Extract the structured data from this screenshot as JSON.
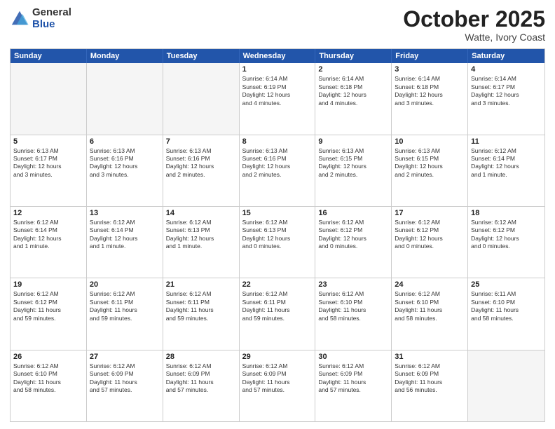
{
  "header": {
    "logo_general": "General",
    "logo_blue": "Blue",
    "month": "October 2025",
    "location": "Watte, Ivory Coast"
  },
  "days_of_week": [
    "Sunday",
    "Monday",
    "Tuesday",
    "Wednesday",
    "Thursday",
    "Friday",
    "Saturday"
  ],
  "weeks": [
    [
      {
        "day": "",
        "info": ""
      },
      {
        "day": "",
        "info": ""
      },
      {
        "day": "",
        "info": ""
      },
      {
        "day": "1",
        "info": "Sunrise: 6:14 AM\nSunset: 6:19 PM\nDaylight: 12 hours\nand 4 minutes."
      },
      {
        "day": "2",
        "info": "Sunrise: 6:14 AM\nSunset: 6:18 PM\nDaylight: 12 hours\nand 4 minutes."
      },
      {
        "day": "3",
        "info": "Sunrise: 6:14 AM\nSunset: 6:18 PM\nDaylight: 12 hours\nand 3 minutes."
      },
      {
        "day": "4",
        "info": "Sunrise: 6:14 AM\nSunset: 6:17 PM\nDaylight: 12 hours\nand 3 minutes."
      }
    ],
    [
      {
        "day": "5",
        "info": "Sunrise: 6:13 AM\nSunset: 6:17 PM\nDaylight: 12 hours\nand 3 minutes."
      },
      {
        "day": "6",
        "info": "Sunrise: 6:13 AM\nSunset: 6:16 PM\nDaylight: 12 hours\nand 3 minutes."
      },
      {
        "day": "7",
        "info": "Sunrise: 6:13 AM\nSunset: 6:16 PM\nDaylight: 12 hours\nand 2 minutes."
      },
      {
        "day": "8",
        "info": "Sunrise: 6:13 AM\nSunset: 6:16 PM\nDaylight: 12 hours\nand 2 minutes."
      },
      {
        "day": "9",
        "info": "Sunrise: 6:13 AM\nSunset: 6:15 PM\nDaylight: 12 hours\nand 2 minutes."
      },
      {
        "day": "10",
        "info": "Sunrise: 6:13 AM\nSunset: 6:15 PM\nDaylight: 12 hours\nand 2 minutes."
      },
      {
        "day": "11",
        "info": "Sunrise: 6:12 AM\nSunset: 6:14 PM\nDaylight: 12 hours\nand 1 minute."
      }
    ],
    [
      {
        "day": "12",
        "info": "Sunrise: 6:12 AM\nSunset: 6:14 PM\nDaylight: 12 hours\nand 1 minute."
      },
      {
        "day": "13",
        "info": "Sunrise: 6:12 AM\nSunset: 6:14 PM\nDaylight: 12 hours\nand 1 minute."
      },
      {
        "day": "14",
        "info": "Sunrise: 6:12 AM\nSunset: 6:13 PM\nDaylight: 12 hours\nand 1 minute."
      },
      {
        "day": "15",
        "info": "Sunrise: 6:12 AM\nSunset: 6:13 PM\nDaylight: 12 hours\nand 0 minutes."
      },
      {
        "day": "16",
        "info": "Sunrise: 6:12 AM\nSunset: 6:12 PM\nDaylight: 12 hours\nand 0 minutes."
      },
      {
        "day": "17",
        "info": "Sunrise: 6:12 AM\nSunset: 6:12 PM\nDaylight: 12 hours\nand 0 minutes."
      },
      {
        "day": "18",
        "info": "Sunrise: 6:12 AM\nSunset: 6:12 PM\nDaylight: 12 hours\nand 0 minutes."
      }
    ],
    [
      {
        "day": "19",
        "info": "Sunrise: 6:12 AM\nSunset: 6:12 PM\nDaylight: 11 hours\nand 59 minutes."
      },
      {
        "day": "20",
        "info": "Sunrise: 6:12 AM\nSunset: 6:11 PM\nDaylight: 11 hours\nand 59 minutes."
      },
      {
        "day": "21",
        "info": "Sunrise: 6:12 AM\nSunset: 6:11 PM\nDaylight: 11 hours\nand 59 minutes."
      },
      {
        "day": "22",
        "info": "Sunrise: 6:12 AM\nSunset: 6:11 PM\nDaylight: 11 hours\nand 59 minutes."
      },
      {
        "day": "23",
        "info": "Sunrise: 6:12 AM\nSunset: 6:10 PM\nDaylight: 11 hours\nand 58 minutes."
      },
      {
        "day": "24",
        "info": "Sunrise: 6:12 AM\nSunset: 6:10 PM\nDaylight: 11 hours\nand 58 minutes."
      },
      {
        "day": "25",
        "info": "Sunrise: 6:11 AM\nSunset: 6:10 PM\nDaylight: 11 hours\nand 58 minutes."
      }
    ],
    [
      {
        "day": "26",
        "info": "Sunrise: 6:12 AM\nSunset: 6:10 PM\nDaylight: 11 hours\nand 58 minutes."
      },
      {
        "day": "27",
        "info": "Sunrise: 6:12 AM\nSunset: 6:09 PM\nDaylight: 11 hours\nand 57 minutes."
      },
      {
        "day": "28",
        "info": "Sunrise: 6:12 AM\nSunset: 6:09 PM\nDaylight: 11 hours\nand 57 minutes."
      },
      {
        "day": "29",
        "info": "Sunrise: 6:12 AM\nSunset: 6:09 PM\nDaylight: 11 hours\nand 57 minutes."
      },
      {
        "day": "30",
        "info": "Sunrise: 6:12 AM\nSunset: 6:09 PM\nDaylight: 11 hours\nand 57 minutes."
      },
      {
        "day": "31",
        "info": "Sunrise: 6:12 AM\nSunset: 6:09 PM\nDaylight: 11 hours\nand 56 minutes."
      },
      {
        "day": "",
        "info": ""
      }
    ]
  ]
}
